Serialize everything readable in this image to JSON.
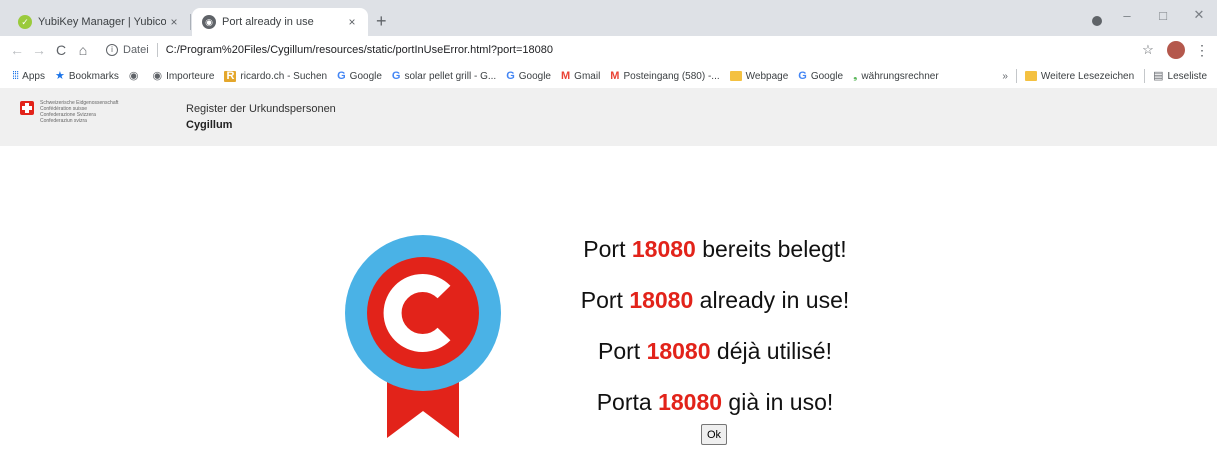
{
  "browser": {
    "tabs": [
      {
        "title": "YubiKey Manager | Yubico",
        "close": "×",
        "active": false
      },
      {
        "title": "Port already in use",
        "close": "×",
        "active": true
      }
    ],
    "new_tab": "+",
    "window_controls": {
      "minimize": "–",
      "maximize": "□",
      "close": "✕"
    },
    "nav": {
      "back": "←",
      "forward": "→",
      "reload": "C",
      "home": "⌂"
    },
    "address": {
      "info": "i",
      "security_label": "Datei",
      "url": "C:/Program%20Files/Cygillum/resources/static/portInUseError.html?port=18080"
    },
    "bookmark_star": "☆",
    "menu": "⋮"
  },
  "bookmarks": {
    "items": [
      {
        "label": "Apps",
        "icon": "apps-grid-icon"
      },
      {
        "label": "Bookmarks",
        "icon": "star-icon"
      },
      {
        "label": "",
        "icon": "globe-icon"
      },
      {
        "label": "Importeure",
        "icon": "globe-icon"
      },
      {
        "label": "ricardo.ch - Suchen",
        "icon": "ricardo-icon"
      },
      {
        "label": "Google",
        "icon": "google-icon"
      },
      {
        "label": "solar pellet grill - G...",
        "icon": "google-icon"
      },
      {
        "label": "Google",
        "icon": "google-icon"
      },
      {
        "label": "Gmail",
        "icon": "gmail-icon"
      },
      {
        "label": "Posteingang (580) -...",
        "icon": "gmail-icon"
      },
      {
        "label": "Webpage",
        "icon": "folder-icon"
      },
      {
        "label": "Google",
        "icon": "google-icon"
      },
      {
        "label": "währungsrechner",
        "icon": "swirl-icon"
      }
    ],
    "more": "»",
    "other_bookmarks": "Weitere Lesezeichen",
    "reading_list": "Leseliste"
  },
  "page": {
    "confederation": [
      "Schweizerische Eidgenossenschaft",
      "Confédération suisse",
      "Confederazione Svizzera",
      "Confederaziun svizra"
    ],
    "register_title": "Register der Urkundspersonen",
    "app_name": "Cygillum",
    "port": "18080",
    "messages": [
      {
        "before": "Port ",
        "after": " bereits belegt!"
      },
      {
        "before": "Port ",
        "after": " already in use!"
      },
      {
        "before": "Port ",
        "after": " déjà utilisé!"
      },
      {
        "before": "Porta ",
        "after": " già in uso!"
      }
    ],
    "ok_label": "Ok"
  },
  "colors": {
    "accent_red": "#e2231a",
    "badge_blue": "#4ab2e6",
    "header_bg": "#f0f0f0",
    "tabstrip_bg": "#dee1e6"
  }
}
